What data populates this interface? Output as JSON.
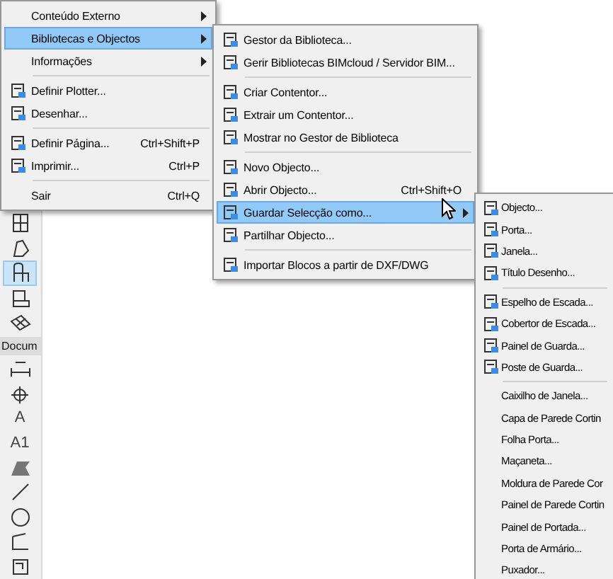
{
  "menus": [
    {
      "items": [
        {
          "kind": "text",
          "label": "Conteúdo Externo",
          "submenu": true,
          "selected": false
        },
        {
          "kind": "text",
          "label": "Bibliotecas e Objectos",
          "submenu": true,
          "selected": true
        },
        {
          "kind": "text",
          "label": "Informações",
          "submenu": true,
          "selected": false
        },
        {
          "kind": "separator"
        },
        {
          "kind": "icon",
          "label": "Definir Plotter...",
          "selected": false
        },
        {
          "kind": "icon",
          "label": "Desenhar...",
          "selected": false
        },
        {
          "kind": "separator"
        },
        {
          "kind": "icon",
          "label": "Definir Página...",
          "shortcut": "Ctrl+Shift+P",
          "selected": false
        },
        {
          "kind": "icon",
          "label": "Imprimir...",
          "shortcut": "Ctrl+P",
          "selected": false
        },
        {
          "kind": "separator"
        },
        {
          "kind": "text",
          "label": "Sair",
          "shortcut": "Ctrl+Q",
          "selected": false
        }
      ]
    },
    {
      "items": [
        {
          "kind": "icon",
          "label": "Gestor da Biblioteca...",
          "selected": false
        },
        {
          "kind": "icon",
          "label": "Gerir Bibliotecas BIMcloud / Servidor BIM...",
          "selected": false
        },
        {
          "kind": "separator"
        },
        {
          "kind": "icon",
          "label": "Criar Contentor...",
          "selected": false
        },
        {
          "kind": "icon",
          "label": "Extrair um Contentor...",
          "selected": false
        },
        {
          "kind": "icon",
          "label": "Mostrar no Gestor de Biblioteca",
          "selected": false
        },
        {
          "kind": "separator"
        },
        {
          "kind": "icon",
          "label": "Novo Objecto...",
          "selected": false
        },
        {
          "kind": "icon",
          "label": "Abrir Objecto...",
          "shortcut": "Ctrl+Shift+O",
          "selected": false
        },
        {
          "kind": "icon",
          "label": "Guardar Selecção como...",
          "submenu": true,
          "selected": true
        },
        {
          "kind": "icon",
          "label": "Partilhar Objecto...",
          "selected": false
        },
        {
          "kind": "separator"
        },
        {
          "kind": "icon",
          "label": "Importar Blocos a partir de DXF/DWG",
          "selected": false
        }
      ]
    },
    {
      "items": [
        {
          "kind": "icon",
          "label": "Objecto...",
          "selected": false
        },
        {
          "kind": "icon",
          "label": "Porta...",
          "selected": false
        },
        {
          "kind": "icon",
          "label": "Janela...",
          "selected": false
        },
        {
          "kind": "icon",
          "label": "Título Desenho...",
          "selected": false
        },
        {
          "kind": "separator"
        },
        {
          "kind": "icon",
          "label": "Espelho de Escada...",
          "selected": false
        },
        {
          "kind": "icon",
          "label": "Cobertor de Escada...",
          "selected": false
        },
        {
          "kind": "icon",
          "label": "Painel de Guarda...",
          "selected": false
        },
        {
          "kind": "icon",
          "label": "Poste de Guarda...",
          "selected": false
        },
        {
          "kind": "separator"
        },
        {
          "kind": "text",
          "label": "Caixilho de Janela...",
          "selected": false
        },
        {
          "kind": "text",
          "label": "Capa de Parede Cortin",
          "selected": false
        },
        {
          "kind": "text",
          "label": "Folha Porta...",
          "selected": false
        },
        {
          "kind": "text",
          "label": "Maçaneta...",
          "selected": false
        },
        {
          "kind": "text",
          "label": "Moldura de Parede Cor",
          "selected": false
        },
        {
          "kind": "text",
          "label": "Painel de Parede Cortin",
          "selected": false
        },
        {
          "kind": "text",
          "label": "Painel de Portada...",
          "selected": false
        },
        {
          "kind": "text",
          "label": "Porta de Armário...",
          "selected": false
        },
        {
          "kind": "text",
          "label": "Puxador...",
          "selected": false
        }
      ]
    }
  ],
  "toolbox": {
    "tools": [
      {
        "selected": false
      },
      {
        "selected": false
      },
      {
        "selected": true
      },
      {
        "selected": false
      },
      {
        "selected": false
      }
    ],
    "section_label": "Docum",
    "section_tools": [
      {
        "selected": false
      },
      {
        "selected": false
      },
      {
        "selected": false,
        "glyph": "A"
      },
      {
        "selected": false,
        "glyph": "A1"
      },
      {
        "selected": false
      },
      {
        "selected": false
      },
      {
        "selected": false
      },
      {
        "selected": false
      },
      {
        "selected": false
      }
    ]
  }
}
